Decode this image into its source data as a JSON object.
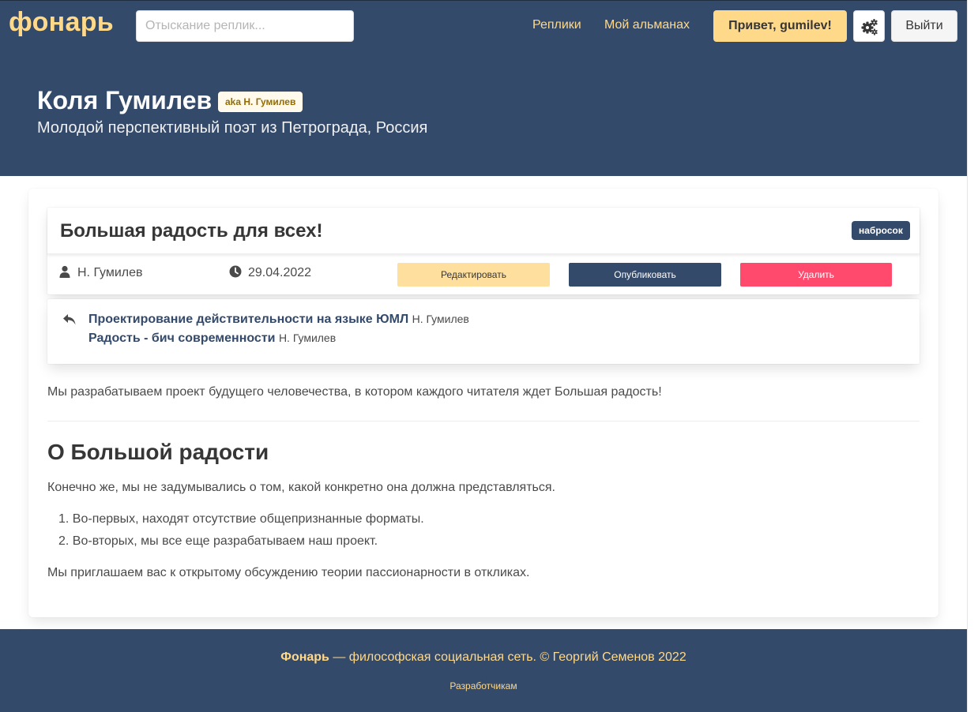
{
  "navbar": {
    "brand": "фонарь",
    "search_placeholder": "Отыскание реплик...",
    "links": [
      "Реплики",
      "Мой альманах"
    ],
    "hello_button": "Привет, gumilev!",
    "settings_icon": "gears-icon",
    "logout_button": "Выйти"
  },
  "hero": {
    "title": "Коля Гумилев",
    "aka_tag": "aka Н. Гумилев",
    "subtitle": "Молодой перспективный поэт из Петрограда, Россия"
  },
  "post": {
    "title": "Большая радость для всех!",
    "status_tag": "набросок",
    "author": "Н. Гумилев",
    "date": "29.04.2022",
    "edit_button": "Редактировать",
    "publish_button": "Опубликовать",
    "delete_button": "Удалить"
  },
  "replies": [
    {
      "title": "Проектирование действительности на языке ЮМЛ",
      "author": "Н. Гумилев"
    },
    {
      "title": "Радость - бич современности",
      "author": "Н. Гумилев"
    }
  ],
  "body": {
    "intro": "Мы разрабатываем проект будущего человечества, в котором каждого читателя ждет Большая радость!",
    "section_title": "О Большой радости",
    "paragraph": "Конечно же, мы не задумывались о том, какой конкретно она должна представляться.",
    "list": [
      "Во-первых, находят отсутствие общепризнанные форматы.",
      "Во-вторых, мы все еще разрабатываем наш проект."
    ],
    "outro": "Мы приглашаем вас к открытому обсуждению теории пассионарности в откликах."
  },
  "footer": {
    "brand": "Фонарь",
    "text": " — философская социальная сеть. © Георгий Семенов 2022",
    "dev_link": "Разработчикам"
  },
  "colors": {
    "primary": "#344a6b",
    "accent": "#ffd98a",
    "danger": "#ff4a6e"
  }
}
